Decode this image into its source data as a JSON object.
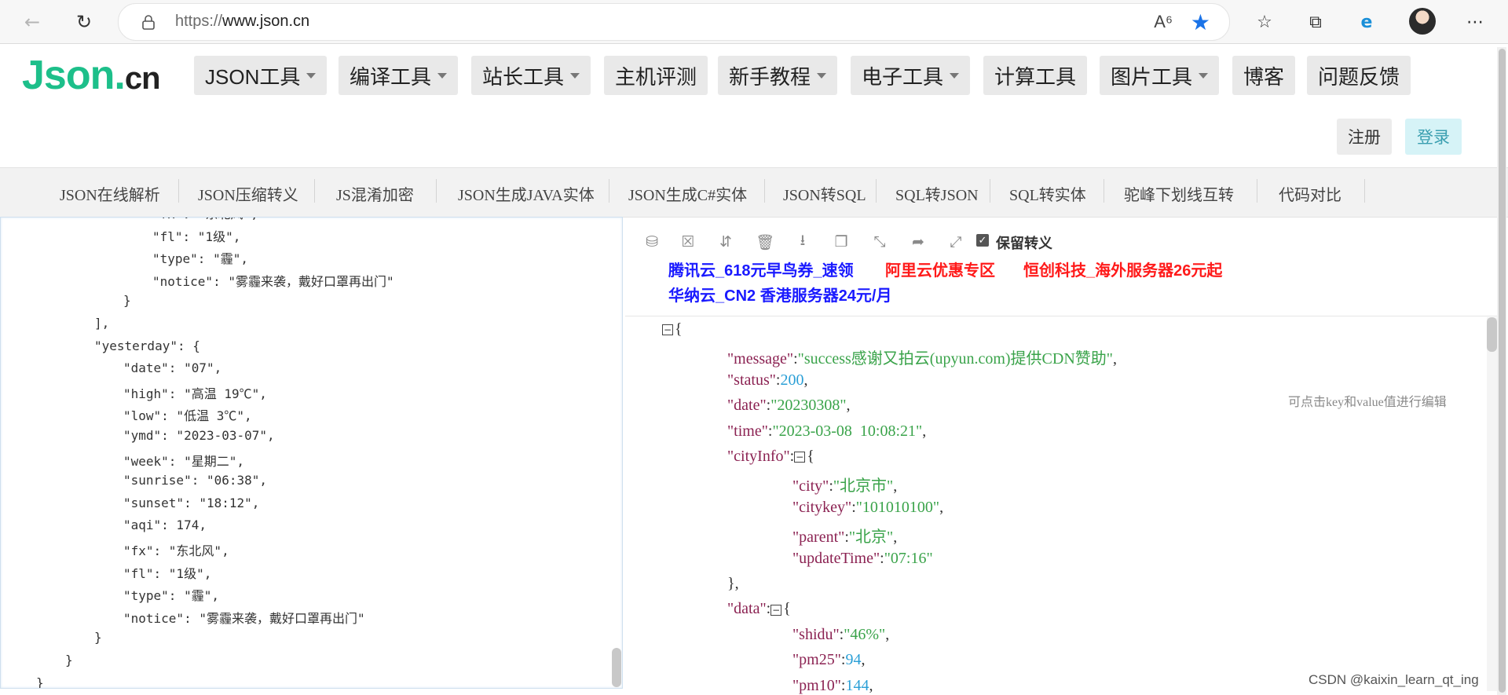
{
  "browser": {
    "url_protocol": "https://",
    "url_host": "www.json.cn",
    "back_icon": "back-arrow-icon",
    "reload_icon": "reload-icon",
    "read_aloud_label": "Â",
    "icons": [
      "favorites-icon",
      "collections-icon",
      "edge-icon",
      "profile-avatar",
      "more-icon"
    ]
  },
  "site": {
    "logo_main": "Json",
    "logo_dot": ".",
    "logo_cn": "cn",
    "menu": [
      {
        "label": "JSON工具",
        "dropdown": true
      },
      {
        "label": "编译工具",
        "dropdown": true
      },
      {
        "label": "站长工具",
        "dropdown": true
      },
      {
        "label": "主机评测",
        "dropdown": false
      },
      {
        "label": "新手教程",
        "dropdown": true
      },
      {
        "label": "电子工具",
        "dropdown": true
      },
      {
        "label": "计算工具",
        "dropdown": false
      },
      {
        "label": "图片工具",
        "dropdown": true
      },
      {
        "label": "博客",
        "dropdown": false
      },
      {
        "label": "问题反馈",
        "dropdown": false
      }
    ],
    "register_label": "注册",
    "login_label": "登录"
  },
  "tool_tabs": [
    "JSON在线解析",
    "JSON压缩转义",
    "JS混淆加密",
    "JSON生成JAVA实体",
    "JSON生成C#实体",
    "JSON转SQL",
    "SQL转JSON",
    "SQL转实体",
    "驼峰下划线互转",
    "代码对比"
  ],
  "editor": {
    "lines": [
      {
        "indent": 4,
        "text": "\"fx\": \"东北风\","
      },
      {
        "indent": 4,
        "text": "\"fl\": \"1级\","
      },
      {
        "indent": 4,
        "text": "\"type\": \"霾\","
      },
      {
        "indent": 4,
        "text": "\"notice\": \"雾霾来袭，戴好口罩再出门\""
      },
      {
        "indent": 3,
        "text": "}"
      },
      {
        "indent": 2,
        "text": "],"
      },
      {
        "indent": 2,
        "text": "\"yesterday\": {"
      },
      {
        "indent": 3,
        "text": "\"date\": \"07\","
      },
      {
        "indent": 3,
        "text": "\"high\": \"高温 19℃\","
      },
      {
        "indent": 3,
        "text": "\"low\": \"低温 3℃\","
      },
      {
        "indent": 3,
        "text": "\"ymd\": \"2023-03-07\","
      },
      {
        "indent": 3,
        "text": "\"week\": \"星期二\","
      },
      {
        "indent": 3,
        "text": "\"sunrise\": \"06:38\","
      },
      {
        "indent": 3,
        "text": "\"sunset\": \"18:12\","
      },
      {
        "indent": 3,
        "text": "\"aqi\": 174,"
      },
      {
        "indent": 3,
        "text": "\"fx\": \"东北风\","
      },
      {
        "indent": 3,
        "text": "\"fl\": \"1级\","
      },
      {
        "indent": 3,
        "text": "\"type\": \"霾\","
      },
      {
        "indent": 3,
        "text": "\"notice\": \"雾霾来袭，戴好口罩再出门\""
      },
      {
        "indent": 2,
        "text": "}"
      },
      {
        "indent": 1,
        "text": "}"
      },
      {
        "indent": 0,
        "text": "}"
      }
    ]
  },
  "right_toolbar": {
    "icons": [
      "database-icon",
      "excel-icon",
      "sort-icon",
      "trash-icon",
      "download-icon",
      "copy-icon",
      "compress-icon",
      "share-icon",
      "expand-icon"
    ],
    "keep_escape_label": "保留转义",
    "keep_escape_checked": true
  },
  "ads": [
    {
      "text": "腾讯云_618元早鸟券_速领",
      "color": "#1a1aff"
    },
    {
      "text": "阿里云优惠专区",
      "color": "#ff1a1a"
    },
    {
      "text": "恒创科技_海外服务器26元起",
      "color": "#ff1a1a"
    },
    {
      "text": "华纳云_CN2 香港服务器24元/月",
      "color": "#1a1aff"
    }
  ],
  "tree": {
    "edit_hint": "可点击key和value值进行编辑",
    "lines": [
      {
        "level": 0,
        "fold": "−",
        "open": "{"
      },
      {
        "level": 1,
        "key": "message",
        "value": "success感谢又拍云(upyun.com)提供CDN赞助",
        "vtype": "string",
        "comma": true
      },
      {
        "level": 1,
        "key": "status",
        "value": "200",
        "vtype": "number",
        "comma": true
      },
      {
        "level": 1,
        "key": "date",
        "value": "20230308",
        "vtype": "string",
        "comma": true
      },
      {
        "level": 1,
        "key": "time",
        "value": "2023-03-08  10:08:21",
        "vtype": "string",
        "comma": true
      },
      {
        "level": 1,
        "key": "cityInfo",
        "fold": "−",
        "open": "{"
      },
      {
        "level": 2,
        "key": "city",
        "value": "北京市",
        "vtype": "string",
        "comma": true
      },
      {
        "level": 2,
        "key": "citykey",
        "value": "101010100",
        "vtype": "string",
        "comma": true
      },
      {
        "level": 2,
        "key": "parent",
        "value": "北京",
        "vtype": "string",
        "comma": true
      },
      {
        "level": 2,
        "key": "updateTime",
        "value": "07:16",
        "vtype": "string",
        "comma": false
      },
      {
        "level": 1,
        "close": "},"
      },
      {
        "level": 1,
        "key": "data",
        "fold": "−",
        "open": "{"
      },
      {
        "level": 2,
        "key": "shidu",
        "value": "46%",
        "vtype": "string",
        "comma": true
      },
      {
        "level": 2,
        "key": "pm25",
        "value": "94",
        "vtype": "number",
        "comma": true
      },
      {
        "level": 2,
        "key": "pm10",
        "value": "144",
        "vtype": "number",
        "comma": true
      }
    ]
  },
  "watermark": "CSDN @kaixin_learn_qt_ing"
}
